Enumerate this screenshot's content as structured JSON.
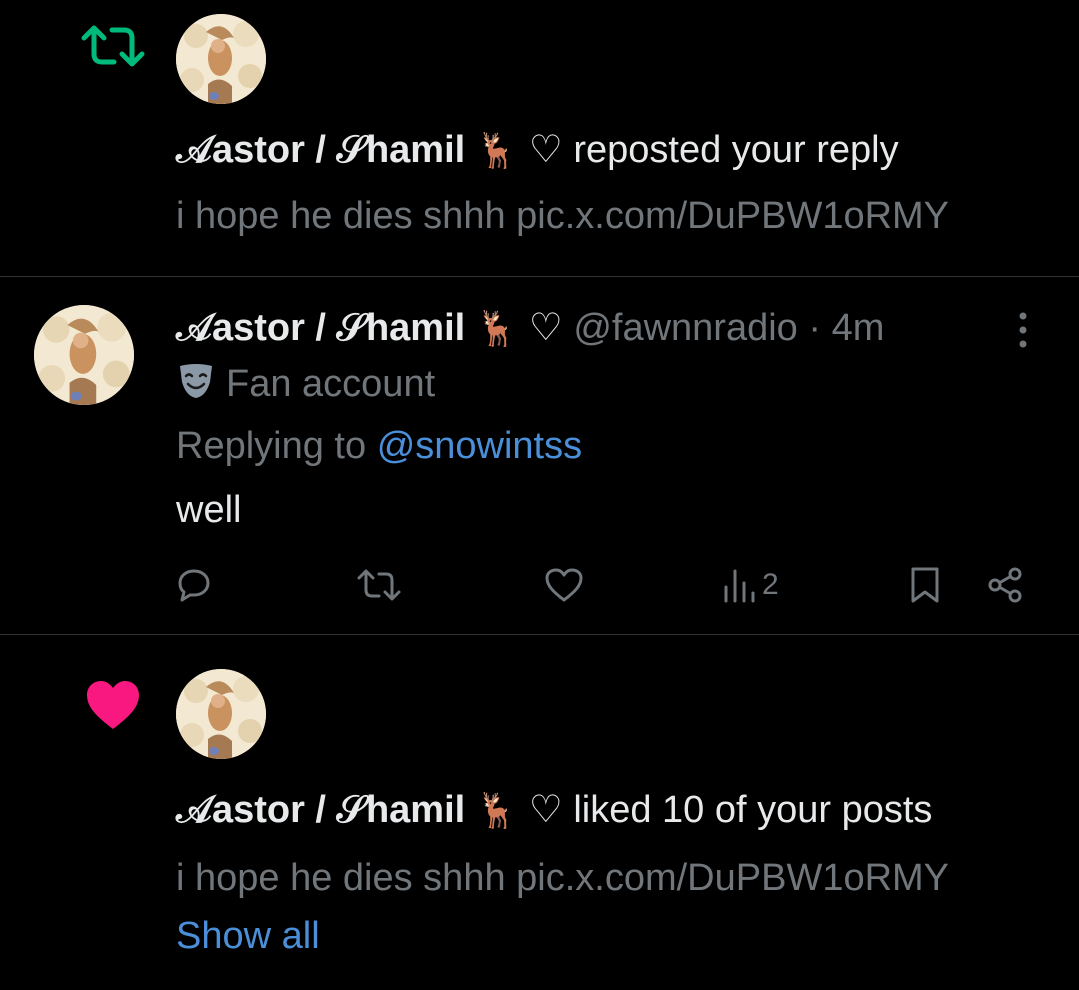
{
  "notifications": [
    {
      "type": "repost",
      "icon": "repost-icon",
      "icon_color": "#00ba7c",
      "display_name": "𝒜astor / 𝒮hamil",
      "name_emoji": "🦌",
      "heart_glyph": "♡",
      "action_text": "reposted your reply",
      "preview_text": "i hope he dies shhh pic.x.com/DuPBW1oRMY"
    },
    {
      "type": "reply",
      "display_name": "𝒜astor / 𝒮hamil",
      "name_emoji": "🦌",
      "heart_glyph": "♡",
      "handle": "@fawnnradio",
      "separator": "·",
      "time": "4m",
      "badge_icon": "theater-mask-icon",
      "badge_text": "Fan account",
      "replying_prefix": "Replying to",
      "replying_to": "@snowintss",
      "body": "well",
      "actions": {
        "reply_count": "",
        "repost_count": "",
        "like_count": "",
        "views_count": "2"
      }
    },
    {
      "type": "like",
      "icon": "heart-icon",
      "icon_color": "#f91880",
      "display_name": "𝒜astor / 𝒮hamil",
      "name_emoji": "🦌",
      "heart_glyph": "♡",
      "action_text": "liked 10 of your posts",
      "preview_text": "i hope he dies shhh pic.x.com/DuPBW1oRMY",
      "show_all": "Show all"
    }
  ],
  "colors": {
    "background": "#000000",
    "text_primary": "#e7e9ea",
    "text_muted": "#71767b",
    "link": "#4a8fd8",
    "divider": "#2f3336"
  }
}
